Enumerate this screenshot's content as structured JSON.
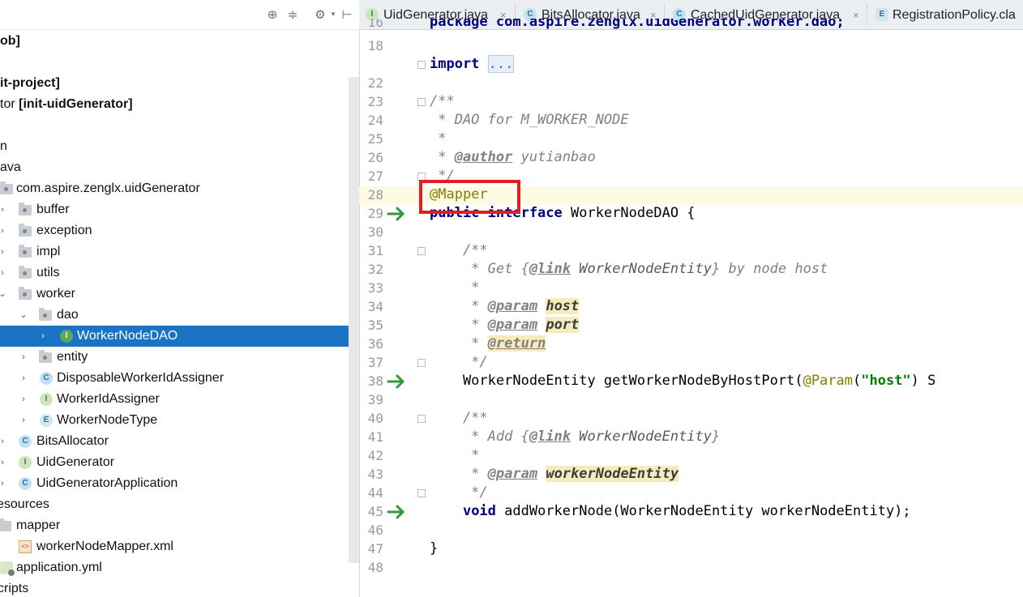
{
  "tree": {
    "rows": [
      {
        "id": "r0",
        "label": "ob]",
        "bold": true
      },
      {
        "id": "r1",
        "label": "it-project]",
        "bold": true
      },
      {
        "id": "r2",
        "label_plain": "tor ",
        "label_bold": "[init-uidGenerator]"
      },
      {
        "id": "r3",
        "label": "n"
      },
      {
        "id": "r4",
        "label": "ava"
      },
      {
        "id": "r5",
        "label": "com.aspire.zenglx.uidGenerator"
      },
      {
        "id": "r6",
        "label": "buffer"
      },
      {
        "id": "r7",
        "label": "exception"
      },
      {
        "id": "r8",
        "label": "impl"
      },
      {
        "id": "r9",
        "label": "utils"
      },
      {
        "id": "r10",
        "label": "worker"
      },
      {
        "id": "r11",
        "label": "dao"
      },
      {
        "id": "r12",
        "label": "WorkerNodeDAO"
      },
      {
        "id": "r13",
        "label": "entity"
      },
      {
        "id": "r14",
        "label": "DisposableWorkerIdAssigner"
      },
      {
        "id": "r15",
        "label": "WorkerIdAssigner"
      },
      {
        "id": "r16",
        "label": "WorkerNodeType"
      },
      {
        "id": "r17",
        "label": "BitsAllocator"
      },
      {
        "id": "r18",
        "label": "UidGenerator"
      },
      {
        "id": "r19",
        "label": "UidGeneratorApplication"
      },
      {
        "id": "r20",
        "label": "esources"
      },
      {
        "id": "r21",
        "label": "mapper"
      },
      {
        "id": "r22",
        "label": "workerNodeMapper.xml"
      },
      {
        "id": "r23",
        "label": "application.yml"
      },
      {
        "id": "r24",
        "label": "cripts"
      }
    ],
    "icon_letters": {
      "c": "C",
      "i": "I",
      "e": "E",
      "xml": "<>"
    }
  },
  "tabs": [
    {
      "label": "UidGenerator.java",
      "icon": "I",
      "close": "×"
    },
    {
      "label": "BitsAllocator.java",
      "icon": "C",
      "close": "×"
    },
    {
      "label": "CachedUidGenerator.java",
      "icon": "C",
      "close": "×"
    },
    {
      "label": "RegistrationPolicy.cla",
      "icon": "E"
    }
  ],
  "editor": {
    "line_numbers": [
      "16",
      "18",
      "22",
      "23",
      "24",
      "25",
      "26",
      "27",
      "28",
      "29",
      "30",
      "31",
      "32",
      "33",
      "34",
      "35",
      "36",
      "37",
      "38",
      "39",
      "40",
      "41",
      "42",
      "43",
      "44",
      "45",
      "46",
      "47",
      "48"
    ],
    "code": {
      "l16": "package com.aspire.zenglx.uidGenerator.worker.dao;",
      "l18_kw": "import",
      "l18_dots": "...",
      "l23": "/**",
      "l24": " * DAO for M_WORKER_NODE",
      "l25": " *",
      "l26_pre": " * ",
      "l26_tag": "@author",
      "l26_post": " yutianbao",
      "l27": " */",
      "l28": "@Mapper",
      "l29_kw": "public interface",
      "l29_rest": " WorkerNodeDAO {",
      "l31": "    /**",
      "l32_pre": "     * Get {",
      "l32_tag": "@link",
      "l32_mid": " WorkerNodeEntity",
      "l32_post": "} by node host",
      "l33": "     *",
      "l34_pre": "     * ",
      "l34_tag": "@param",
      "l34_param": "host",
      "l35_pre": "     * ",
      "l35_tag": "@param",
      "l35_param": "port",
      "l36_pre": "     * ",
      "l36_tag": "@return",
      "l37": "     */",
      "l38_pre": "    WorkerNodeEntity getWorkerNodeByHostPort(",
      "l38_ann": "@Param",
      "l38_p1": "(",
      "l38_str": "\"host\"",
      "l38_post": ") S",
      "l40": "    /**",
      "l41_pre": "     * Add {",
      "l41_tag": "@link",
      "l41_mid": " WorkerNodeEntity",
      "l41_post": "}",
      "l42": "     *",
      "l43_pre": "     * ",
      "l43_tag": "@param",
      "l43_param": "workerNodeEntity",
      "l44": "     */",
      "l45_kw": "void",
      "l45_rest": " addWorkerNode(WorkerNodeEntity workerNodeEntity);",
      "l47": "}"
    }
  }
}
